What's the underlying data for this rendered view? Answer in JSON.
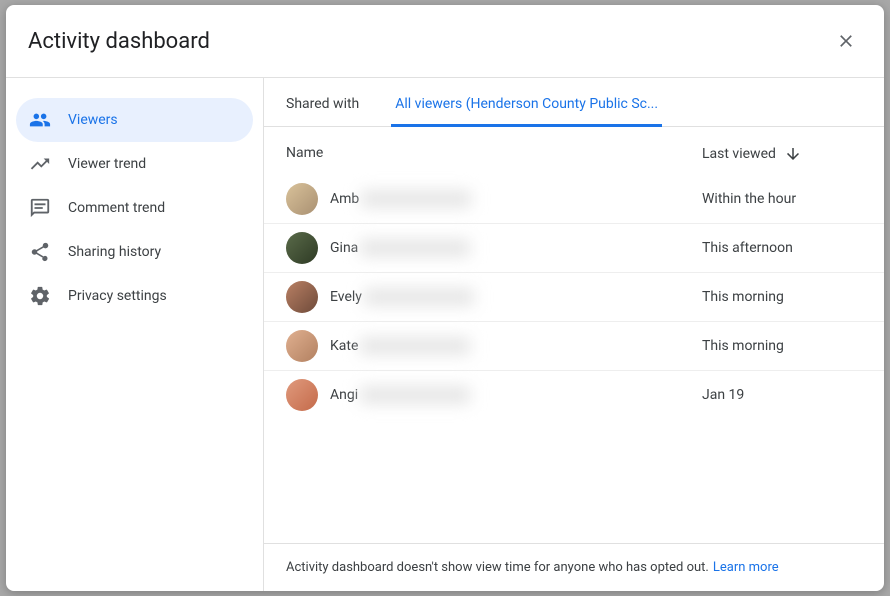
{
  "header": {
    "title": "Activity dashboard"
  },
  "sidebar": {
    "items": [
      {
        "label": "Viewers"
      },
      {
        "label": "Viewer trend"
      },
      {
        "label": "Comment trend"
      },
      {
        "label": "Sharing history"
      },
      {
        "label": "Privacy settings"
      }
    ]
  },
  "tabs": {
    "shared_with": "Shared with",
    "all_viewers": "All viewers",
    "all_viewers_paren": "(Henderson County Public Sc..."
  },
  "table": {
    "name_header": "Name",
    "last_header": "Last viewed",
    "rows": [
      {
        "first": "Amb",
        "last_viewed": "Within the hour",
        "avatar_bg": "linear-gradient(135deg,#d9c29a,#a99072)"
      },
      {
        "first": "Gina",
        "last_viewed": "This afternoon",
        "avatar_bg": "linear-gradient(135deg,#5a6b4a,#2e3a24)"
      },
      {
        "first": "Evely",
        "last_viewed": "This morning",
        "avatar_bg": "linear-gradient(135deg,#b98064,#6e4a3a)"
      },
      {
        "first": "Kate",
        "last_viewed": "This morning",
        "avatar_bg": "linear-gradient(135deg,#e0b090,#b28060)"
      },
      {
        "first": "Angi",
        "last_viewed": "Jan 19",
        "avatar_bg": "linear-gradient(135deg,#e09a7d,#c46a4a)"
      }
    ]
  },
  "footer": {
    "message": "Activity dashboard doesn't show view time for anyone who has opted out.",
    "link": "Learn more"
  }
}
